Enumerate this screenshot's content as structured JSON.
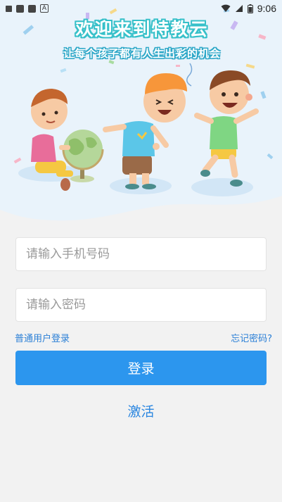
{
  "status_bar": {
    "time": "9:06",
    "left_icons": [
      "notification-icon",
      "app-icon",
      "app-icon",
      "a-icon"
    ],
    "a_label": "A"
  },
  "banner": {
    "title": "欢迎来到特教云",
    "subtitle": "让每个孩子都有人生出彩的机会"
  },
  "form": {
    "phone_placeholder": "请输入手机号码",
    "password_placeholder": "请输入密码",
    "user_login_link": "普通用户登录",
    "forgot_password_link": "忘记密码?",
    "login_button": "登录",
    "activate_link": "激活"
  },
  "colors": {
    "primary": "#2c96ee",
    "link": "#2a7fd6",
    "background": "#f2f2f2",
    "banner_bg": "#e9f3fb",
    "title_outline": "#36c0c9"
  }
}
